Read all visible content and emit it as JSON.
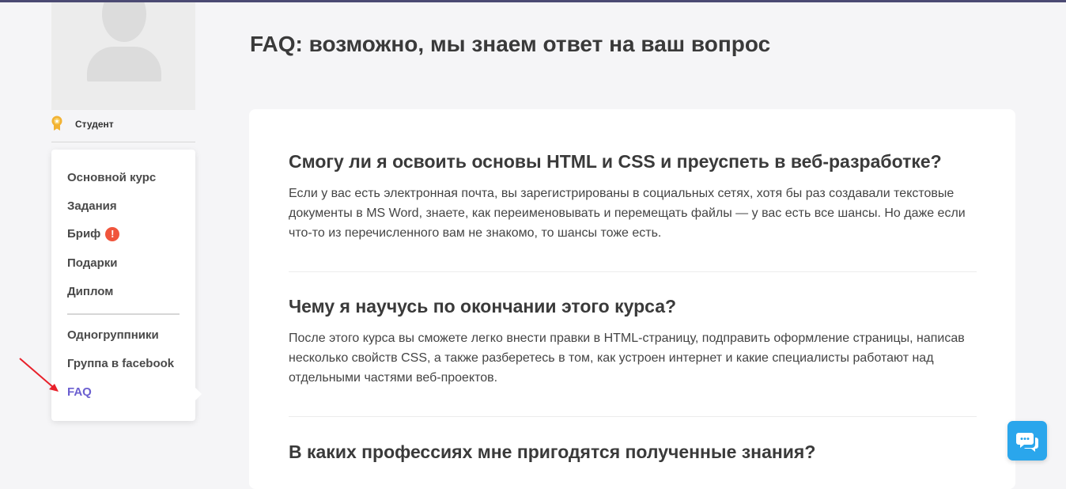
{
  "profile": {
    "rank_label": "Студент"
  },
  "nav": {
    "items": [
      "Основной курс",
      "Задания",
      "Бриф",
      "Подарки",
      "Диплом"
    ],
    "brief_badge": "!",
    "secondary_items": [
      "Одногруппники",
      "Группа в facebook",
      "FAQ"
    ],
    "active_item": "FAQ"
  },
  "page": {
    "title": "FAQ: возможно, мы знаем ответ на ваш вопрос"
  },
  "faq": [
    {
      "question": "Смогу ли я освоить основы HTML и CSS и преуспеть в веб-разработке?",
      "answer": "Если у вас есть электронная почта, вы зарегистрированы в социальных сетях, хотя бы раз создавали текстовые документы в MS Word, знаете, как переименовывать и перемещать файлы — у вас есть все шансы. Но даже если что-то из перечисленного вам не знакомо, то шансы тоже есть."
    },
    {
      "question": "Чему я научусь по окончании этого курса?",
      "answer": "После этого курса вы сможете легко внести правки в HTML-страницу, подправить оформление страницы, написав несколько свойств CSS, а также разберетесь в том, как устроен интернет и какие специалисты работают над отдельными частями веб-проектов."
    },
    {
      "question": "В каких профессиях мне пригодятся полученные знания?",
      "answer": ""
    }
  ],
  "icons": {
    "avatar": "avatar-placeholder-icon",
    "medal": "medal-icon",
    "chat": "chat-icon",
    "arrow": "red-arrow-annotation"
  },
  "colors": {
    "accent": "#6b5fd0",
    "badge": "#f0553c",
    "chat_button": "#2aa6ec",
    "arrow": "#e8202a"
  }
}
